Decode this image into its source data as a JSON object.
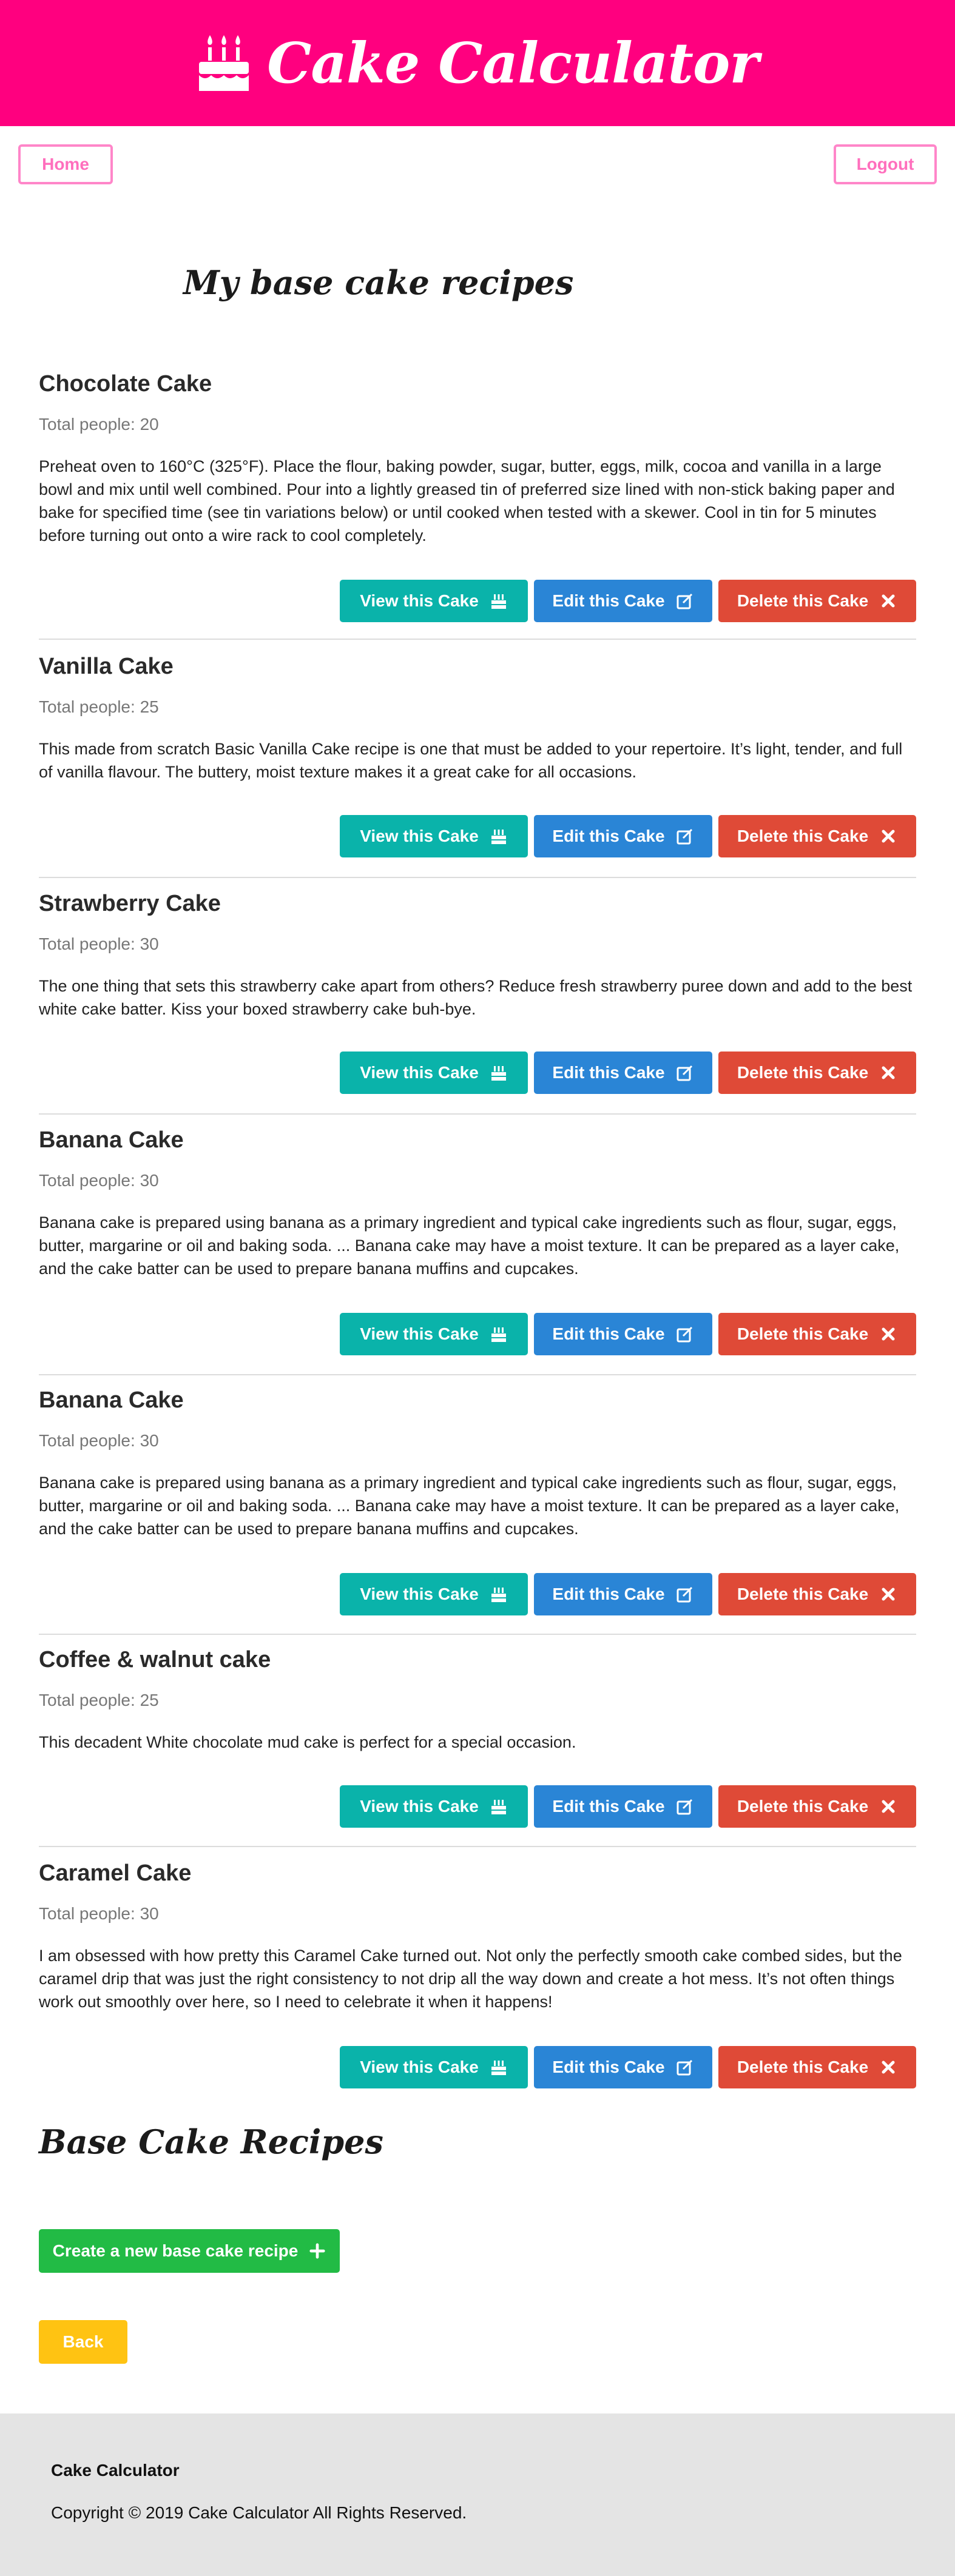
{
  "header": {
    "title": "Cake Calculator",
    "logo_icon": "birthday-cake-icon"
  },
  "nav": {
    "home_label": "Home",
    "logout_label": "Logout"
  },
  "page_title": "My base cake recipes",
  "recipe_labels": {
    "view": "View this Cake",
    "edit": "Edit this Cake",
    "delete": "Delete this Cake"
  },
  "recipes": [
    {
      "name": "Chocolate Cake",
      "people": "Total people: 20",
      "description": "Preheat oven to 160°C (325°F). Place the flour, baking powder, sugar, butter, eggs, milk, cocoa and vanilla in a large bowl and mix until well combined. Pour into a lightly greased tin of preferred size lined with non-stick baking paper and bake for specified time (see tin variations below) or until cooked when tested with a skewer. Cool in tin for 5 minutes before turning out onto a wire rack to cool completely."
    },
    {
      "name": "Vanilla Cake",
      "people": "Total people: 25",
      "description": "This made from scratch Basic Vanilla Cake recipe is one that must be added to your repertoire. It’s light, tender, and full of vanilla flavour. The buttery, moist texture makes it a great cake for all occasions."
    },
    {
      "name": "Strawberry Cake",
      "people": "Total people: 30",
      "description": "The one thing that sets this strawberry cake apart from others? Reduce fresh strawberry puree down and add to the best white cake batter. Kiss your boxed strawberry cake buh-bye."
    },
    {
      "name": "Banana Cake",
      "people": "Total people: 30",
      "description": "Banana cake is prepared using banana as a primary ingredient and typical cake ingredients such as flour, sugar, eggs, butter, margarine or oil and baking soda. ... Banana cake may have a moist texture. It can be prepared as a layer cake, and the cake batter can be used to prepare banana muffins and cupcakes."
    },
    {
      "name": "Banana Cake",
      "people": "Total people: 30",
      "description": "Banana cake is prepared using banana as a primary ingredient and typical cake ingredients such as flour, sugar, eggs, butter, margarine or oil and baking soda. ... Banana cake may have a moist texture. It can be prepared as a layer cake, and the cake batter can be used to prepare banana muffins and cupcakes."
    },
    {
      "name": "Coffee & walnut cake",
      "people": "Total people: 25",
      "description": "This decadent White chocolate mud cake is perfect for a special occasion."
    },
    {
      "name": "Caramel Cake",
      "people": "Total people: 30",
      "description": "I am obsessed with how pretty this Caramel Cake turned out. Not only the perfectly smooth cake combed sides, but the caramel drip that was just the right consistency to not drip all the way down and create a hot mess. It’s not often things work out smoothly over here, so I need to celebrate it when it happens!"
    }
  ],
  "section_title": "Base Cake Recipes",
  "create_label": "Create a new base cake recipe",
  "back_label": "Back",
  "footer": {
    "title": "Cake Calculator",
    "copyright": "Copyright © 2019 Cake Calculator All Rights Reserved."
  },
  "colors": {
    "brand": "#ff007f",
    "view": "#0ab3aa",
    "edit": "#2a85d6",
    "delete": "#df4a37",
    "create": "#22bb45",
    "back": "#ffc312"
  }
}
